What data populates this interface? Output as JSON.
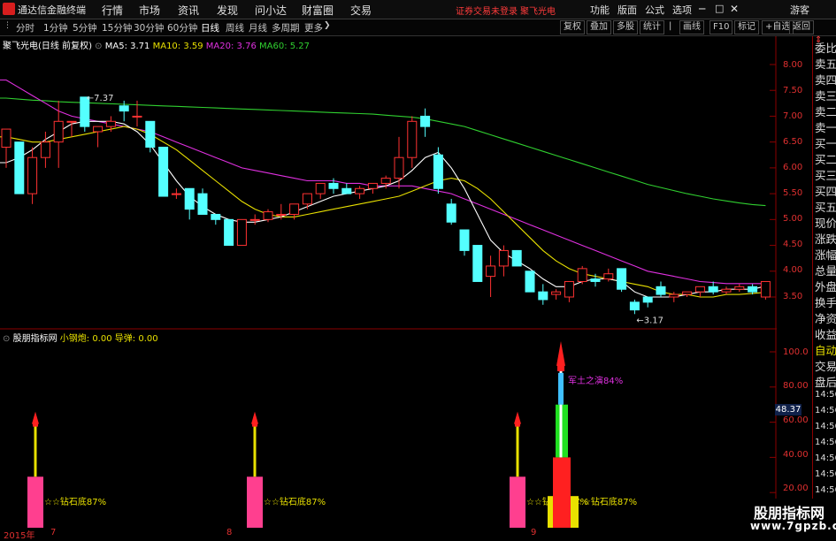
{
  "app": {
    "title": "通达信金融终端"
  },
  "menu": [
    {
      "label": "行情"
    },
    {
      "label": "市场"
    },
    {
      "label": "资讯"
    },
    {
      "label": "发现"
    },
    {
      "label": "问小达"
    },
    {
      "label": "财富圈"
    },
    {
      "label": "交易"
    }
  ],
  "status": {
    "login": "证券交易未登录",
    "stock": "聚飞光电"
  },
  "menu_right": [
    {
      "label": "功能"
    },
    {
      "label": "版面"
    },
    {
      "label": "公式"
    },
    {
      "label": "选项"
    },
    {
      "label": "游客"
    }
  ],
  "periods": [
    {
      "label": "分时"
    },
    {
      "label": "1分钟"
    },
    {
      "label": "5分钟"
    },
    {
      "label": "15分钟"
    },
    {
      "label": "30分钟"
    },
    {
      "label": "60分钟"
    },
    {
      "label": "日线"
    },
    {
      "label": "周线"
    },
    {
      "label": "月线"
    },
    {
      "label": "多周期"
    },
    {
      "label": "更多"
    }
  ],
  "tools": [
    {
      "label": "复权"
    },
    {
      "label": "叠加"
    },
    {
      "label": "多股"
    },
    {
      "label": "统计"
    },
    {
      "label": "画线"
    },
    {
      "label": "F10"
    },
    {
      "label": "标记"
    },
    {
      "label": "+自选"
    },
    {
      "label": "返回"
    }
  ],
  "main_legend": {
    "name": "聚飞光电(日线 前复权)",
    "ma5": "MA5: 3.71",
    "ma10": "MA10: 3.59",
    "ma20": "MA20: 3.76",
    "ma60": "MA60: 5.27"
  },
  "sub_legend": {
    "name": "股朋指标网",
    "item1": "小钢炮: 0.00",
    "item2": "导弹: 0.00"
  },
  "annotations": {
    "high": "7.37",
    "low": "3.17",
    "diamond": "☆☆钻石底87%",
    "rocket": "军土之演84%",
    "current": "48.37"
  },
  "right_panel": [
    "委比",
    "卖五",
    "卖四",
    "卖三",
    "卖二",
    "卖一",
    "买一",
    "买二",
    "买三",
    "买四",
    "买五",
    "现价",
    "涨跌",
    "涨幅",
    "总量",
    "外盘",
    "换手",
    "净资",
    "收益"
  ],
  "right_panel2": [
    "自动",
    "交易",
    "盘后"
  ],
  "right_panel2_times": [
    "14:56",
    "14:56",
    "14:56",
    "14:56",
    "14:56",
    "14:56",
    "14:56",
    "14:56",
    "14:56"
  ],
  "price_axis": [
    "8.00",
    "7.50",
    "7.00",
    "6.50",
    "6.00",
    "5.50",
    "5.00",
    "4.50",
    "4.00",
    "3.50"
  ],
  "ind_axis": [
    "100.0",
    "80.00",
    "60.00",
    "40.00",
    "20.00"
  ],
  "date_axis": [
    "2015年",
    "7",
    "8",
    "9"
  ],
  "watermark": {
    "line1": "股朋指标网",
    "line2": "www.7gpzb.com"
  },
  "colors": {
    "up": "#ff3232",
    "down": "#54ffff",
    "ma5": "#ffffff",
    "ma10": "#e8e000",
    "ma20": "#e030e0",
    "ma60": "#30d030"
  },
  "chart_data": {
    "type": "candlestick",
    "candles": [
      [
        6.4,
        6.75,
        6.0,
        6.75
      ],
      [
        6.5,
        6.5,
        5.5,
        5.5
      ],
      [
        5.5,
        6.4,
        5.3,
        6.2
      ],
      [
        6.2,
        6.7,
        6.0,
        6.5
      ],
      [
        6.5,
        7.3,
        6.0,
        6.9
      ],
      [
        6.9,
        6.9,
        6.6,
        6.9
      ],
      [
        7.37,
        7.37,
        6.7,
        6.8
      ],
      [
        6.7,
        6.8,
        6.4,
        6.8
      ],
      [
        6.8,
        7.0,
        6.7,
        6.9
      ],
      [
        7.2,
        7.3,
        6.9,
        7.1
      ],
      [
        7.0,
        7.3,
        6.8,
        7.0
      ],
      [
        6.9,
        6.9,
        6.3,
        6.4
      ],
      [
        6.4,
        6.4,
        5.5,
        5.45
      ],
      [
        5.5,
        5.6,
        5.4,
        5.5
      ],
      [
        5.6,
        5.6,
        5.0,
        5.2
      ],
      [
        5.5,
        5.6,
        5.1,
        5.1
      ],
      [
        5.1,
        5.1,
        4.9,
        5.0
      ],
      [
        5.0,
        5.0,
        4.5,
        4.5
      ],
      [
        4.5,
        5.0,
        4.5,
        5.0
      ],
      [
        5.0,
        5.1,
        4.9,
        5.0
      ],
      [
        5.0,
        5.2,
        4.95,
        5.15
      ],
      [
        5.1,
        5.3,
        5.0,
        5.1
      ],
      [
        5.1,
        5.3,
        5.0,
        5.3
      ],
      [
        5.3,
        5.5,
        5.2,
        5.5
      ],
      [
        5.5,
        5.6,
        5.4,
        5.7
      ],
      [
        5.7,
        5.8,
        5.5,
        5.6
      ],
      [
        5.6,
        5.7,
        5.5,
        5.5
      ],
      [
        5.5,
        5.65,
        5.4,
        5.6
      ],
      [
        5.6,
        5.7,
        5.5,
        5.7
      ],
      [
        5.7,
        5.85,
        5.6,
        5.8
      ],
      [
        5.8,
        6.6,
        5.6,
        6.2
      ],
      [
        6.2,
        7.0,
        6.0,
        6.9
      ],
      [
        7.0,
        7.15,
        6.6,
        6.8
      ],
      [
        6.25,
        6.4,
        5.5,
        5.6
      ],
      [
        5.3,
        5.4,
        4.9,
        4.95
      ],
      [
        4.8,
        4.8,
        4.3,
        4.4
      ],
      [
        4.5,
        4.5,
        3.8,
        3.8
      ],
      [
        3.9,
        4.3,
        3.5,
        4.1
      ],
      [
        4.1,
        4.5,
        3.9,
        4.4
      ],
      [
        4.4,
        4.4,
        4.1,
        4.1
      ],
      [
        4.0,
        4.0,
        3.6,
        3.6
      ],
      [
        3.6,
        3.75,
        3.35,
        3.45
      ],
      [
        3.55,
        3.65,
        3.45,
        3.6
      ],
      [
        3.5,
        3.8,
        3.4,
        3.8
      ],
      [
        3.8,
        4.1,
        3.75,
        4.05
      ],
      [
        3.85,
        3.95,
        3.7,
        3.8
      ],
      [
        3.85,
        4.05,
        3.8,
        3.95
      ],
      [
        4.05,
        4.05,
        3.6,
        3.65
      ],
      [
        3.4,
        3.45,
        3.17,
        3.25
      ],
      [
        3.5,
        3.5,
        3.3,
        3.4
      ],
      [
        3.7,
        3.8,
        3.5,
        3.55
      ],
      [
        3.5,
        3.6,
        3.4,
        3.55
      ],
      [
        3.55,
        3.6,
        3.5,
        3.6
      ],
      [
        3.6,
        3.7,
        3.5,
        3.7
      ],
      [
        3.7,
        3.8,
        3.55,
        3.6
      ],
      [
        3.6,
        3.7,
        3.55,
        3.65
      ],
      [
        3.65,
        3.75,
        3.6,
        3.7
      ],
      [
        3.7,
        3.75,
        3.55,
        3.6
      ],
      [
        3.5,
        3.8,
        3.45,
        3.8
      ]
    ],
    "ma5": [
      6.1,
      6.2,
      6.35,
      6.55,
      6.7,
      6.85,
      6.9,
      6.9,
      6.9,
      6.85,
      6.7,
      6.45,
      6.1,
      5.75,
      5.45,
      5.25,
      5.1,
      5.0,
      4.95,
      4.95,
      5.0,
      5.05,
      5.15,
      5.25,
      5.35,
      5.45,
      5.5,
      5.55,
      5.6,
      5.65,
      5.75,
      5.95,
      6.2,
      6.3,
      6.0,
      5.6,
      5.1,
      4.6,
      4.35,
      4.2,
      4.05,
      3.85,
      3.7,
      3.7,
      3.8,
      3.85,
      3.85,
      3.8,
      3.6,
      3.5,
      3.5,
      3.5,
      3.55,
      3.6,
      3.6,
      3.65,
      3.65,
      3.65,
      3.71
    ],
    "ma10": [
      6.6,
      6.55,
      6.5,
      6.5,
      6.55,
      6.6,
      6.65,
      6.7,
      6.75,
      6.8,
      6.75,
      6.65,
      6.5,
      6.35,
      6.15,
      5.95,
      5.75,
      5.55,
      5.35,
      5.2,
      5.1,
      5.05,
      5.05,
      5.1,
      5.15,
      5.2,
      5.25,
      5.3,
      5.35,
      5.4,
      5.45,
      5.55,
      5.65,
      5.75,
      5.8,
      5.75,
      5.6,
      5.4,
      5.15,
      4.9,
      4.65,
      4.4,
      4.2,
      4.05,
      3.95,
      3.9,
      3.85,
      3.8,
      3.75,
      3.7,
      3.6,
      3.55,
      3.55,
      3.5,
      3.5,
      3.55,
      3.55,
      3.57,
      3.59
    ],
    "ma20": [
      7.7,
      7.55,
      7.4,
      7.25,
      7.1,
      7.0,
      6.95,
      6.9,
      6.85,
      6.8,
      6.75,
      6.7,
      6.6,
      6.5,
      6.4,
      6.3,
      6.2,
      6.1,
      6.0,
      5.95,
      5.9,
      5.85,
      5.8,
      5.75,
      5.75,
      5.75,
      5.7,
      5.7,
      5.65,
      5.65,
      5.65,
      5.65,
      5.6,
      5.55,
      5.5,
      5.4,
      5.3,
      5.2,
      5.1,
      5.0,
      4.9,
      4.8,
      4.7,
      4.6,
      4.5,
      4.4,
      4.3,
      4.2,
      4.1,
      4.0,
      3.95,
      3.9,
      3.85,
      3.8,
      3.78,
      3.76,
      3.76,
      3.76,
      3.76
    ],
    "ma60": [
      7.35,
      7.33,
      7.31,
      7.3,
      7.28,
      7.27,
      7.26,
      7.25,
      7.24,
      7.23,
      7.22,
      7.21,
      7.2,
      7.19,
      7.18,
      7.17,
      7.16,
      7.15,
      7.14,
      7.13,
      7.12,
      7.11,
      7.1,
      7.09,
      7.08,
      7.07,
      7.06,
      7.05,
      7.04,
      7.02,
      7.0,
      6.98,
      6.95,
      6.9,
      6.85,
      6.8,
      6.72,
      6.64,
      6.56,
      6.48,
      6.4,
      6.32,
      6.24,
      6.16,
      6.08,
      6.0,
      5.92,
      5.84,
      5.76,
      5.68,
      5.62,
      5.56,
      5.5,
      5.45,
      5.4,
      5.36,
      5.32,
      5.29,
      5.27
    ]
  }
}
